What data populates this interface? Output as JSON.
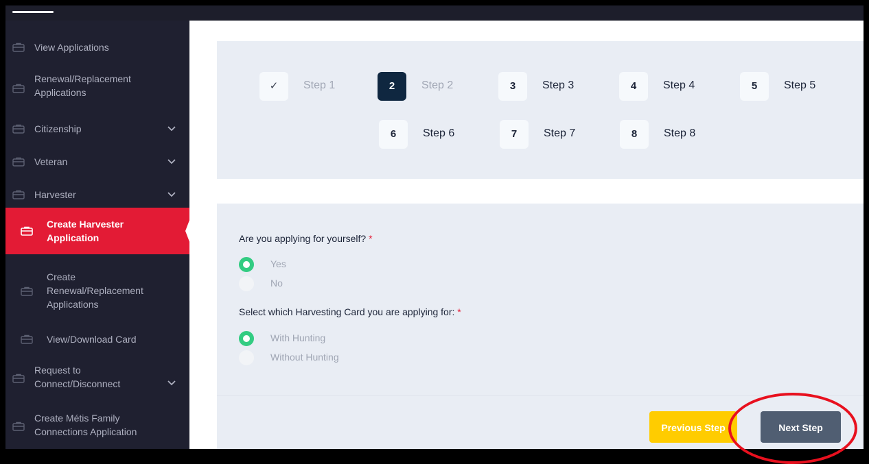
{
  "sidebar": {
    "items": [
      {
        "label": "View Applications"
      },
      {
        "label": "Renewal/Replacement Applications"
      },
      {
        "label": "Citizenship"
      },
      {
        "label": "Veteran"
      },
      {
        "label": "Harvester"
      },
      {
        "label": "Create Harvester Application"
      },
      {
        "label": "Create Renewal/Replacement Applications"
      },
      {
        "label": "View/Download Card"
      },
      {
        "label": "Request to Connect/Disconnect"
      },
      {
        "label": "Create Métis Family Connections Application"
      }
    ]
  },
  "steps": [
    {
      "number": "✓",
      "label": "Step 1",
      "state": "done"
    },
    {
      "number": "2",
      "label": "Step 2",
      "state": "current"
    },
    {
      "number": "3",
      "label": "Step 3",
      "state": "pending"
    },
    {
      "number": "4",
      "label": "Step 4",
      "state": "pending"
    },
    {
      "number": "5",
      "label": "Step 5",
      "state": "pending"
    },
    {
      "number": "6",
      "label": "Step 6",
      "state": "pending"
    },
    {
      "number": "7",
      "label": "Step 7",
      "state": "pending"
    },
    {
      "number": "8",
      "label": "Step 8",
      "state": "pending"
    }
  ],
  "form": {
    "q1": {
      "label": "Are you applying for yourself?",
      "required": "*",
      "options": [
        "Yes",
        "No"
      ],
      "selected": "Yes"
    },
    "q2": {
      "label": "Select which Harvesting Card you are applying for:",
      "required": "*",
      "options": [
        "With Hunting",
        "Without Hunting"
      ],
      "selected": "With Hunting"
    }
  },
  "buttons": {
    "previous": "Previous Step",
    "next": "Next Step"
  },
  "colors": {
    "sidebar_bg": "#1f2030",
    "active": "#e31b35",
    "step_current": "#0f2740",
    "radio_checked": "#33cc82",
    "prev_button": "#ffcc00",
    "next_button": "#505e72",
    "highlight": "#e8101e"
  }
}
